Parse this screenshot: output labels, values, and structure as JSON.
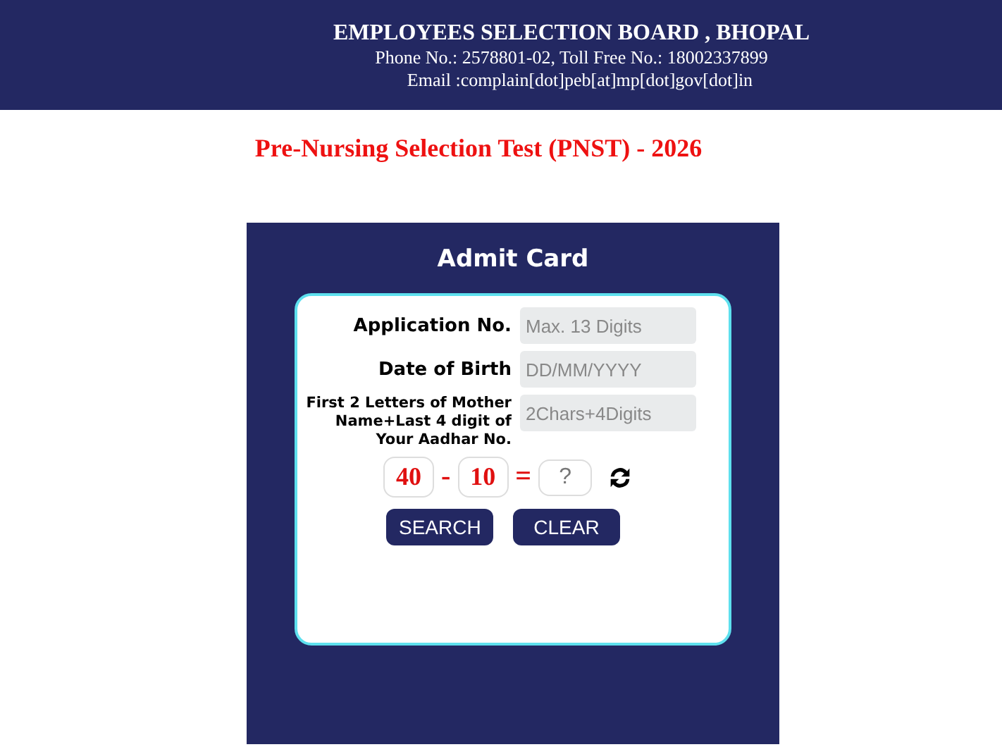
{
  "header": {
    "title": "EMPLOYEES SELECTION BOARD , BHOPAL",
    "phone": "Phone No.: 2578801-02, Toll Free No.: 18002337899",
    "email": "Email :complain[dot]peb[at]mp[dot]gov[dot]in"
  },
  "exam_title": "Pre-Nursing Selection Test (PNST) - 2026",
  "card": {
    "title": "Admit Card",
    "fields": [
      {
        "label": "Application No.",
        "placeholder": "Max. 13 Digits",
        "kind": "normal"
      },
      {
        "label": "Date of Birth",
        "placeholder": "DD/MM/YYYY",
        "kind": "normal"
      },
      {
        "label": "First 2 Letters of Mother Name+Last 4 digit of Your Aadhar No.",
        "placeholder": "2Chars+4Digits",
        "kind": "small"
      }
    ],
    "captcha": {
      "first": "40",
      "operator": "-",
      "second": "10",
      "equals": "=",
      "placeholder": "?"
    },
    "buttons": [
      "SEARCH",
      "CLEAR"
    ]
  }
}
